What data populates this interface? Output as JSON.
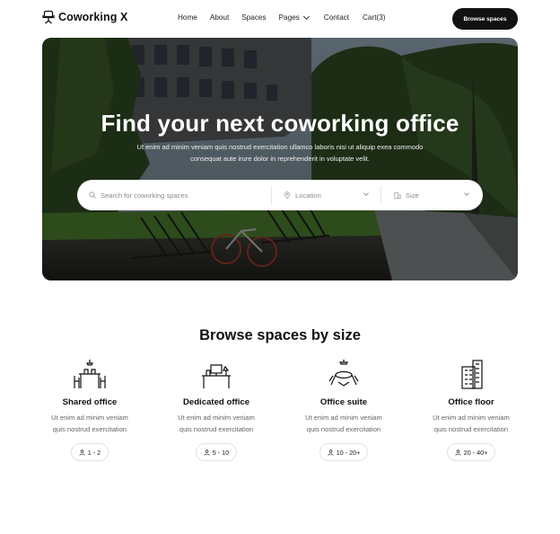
{
  "brand": {
    "name": "Coworking X",
    "icon": "office-chair-icon"
  },
  "nav": {
    "home": "Home",
    "about": "About",
    "spaces": "Spaces",
    "pages": "Pages",
    "contact": "Contact",
    "cart": "Cart(3)"
  },
  "cta_label": "Browse spaces",
  "hero": {
    "title": "Find your next coworking office",
    "subtitle": "Ut enim ad minim veniam quis nostrud exercitation ullamco laboris nisi ut aliquip exea commodo consequat aute irure dolor in reprehenderit in voluptate velit."
  },
  "search": {
    "placeholder": "Search for coworking spaces",
    "location": "Location",
    "size": "Size"
  },
  "browse": {
    "title": "Browse spaces by size",
    "cards": [
      {
        "title": "Shared office",
        "desc1": "Ut enim ad minim veniam",
        "desc2": "quis nostrud exercitation",
        "range": "1 - 2",
        "icon": "shared-desk-icon"
      },
      {
        "title": "Dedicated office",
        "desc1": "Ut enim ad minim veniam",
        "desc2": "quis nostrud exercitation",
        "range": "5 - 10",
        "icon": "desk-chair-icon"
      },
      {
        "title": "Office suite",
        "desc1": "Ut enim ad minim veniam",
        "desc2": "quis nostrud exercitation",
        "range": "10 - 20+",
        "icon": "meeting-table-icon"
      },
      {
        "title": "Office floor",
        "desc1": "Ut enim ad minim veniam",
        "desc2": "quis nostrud exercitation",
        "range": "20 - 40+",
        "icon": "building-icon"
      }
    ]
  },
  "colors": {
    "primary": "#111111",
    "text_muted": "#666666",
    "background": "#ffffff"
  }
}
